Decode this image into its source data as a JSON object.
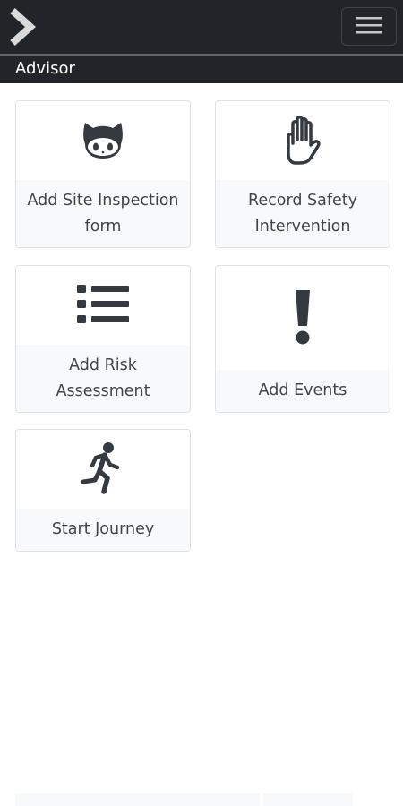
{
  "header": {
    "logo_icon": "chevron-right-icon",
    "menu_icon": "hamburger-menu-icon",
    "section_title": "Advisor"
  },
  "tiles": [
    {
      "icon": "github-octocat-icon",
      "label": "Add Site Inspection form"
    },
    {
      "icon": "raised-hand-icon",
      "label": "Record Safety Intervention"
    },
    {
      "icon": "list-icon",
      "label": "Add Risk Assessment"
    },
    {
      "icon": "exclamation-icon",
      "label": "Add Events"
    },
    {
      "icon": "running-person-icon",
      "label": "Start Journey"
    }
  ],
  "colors": {
    "header_bg": "#212529",
    "icon": "#343a40",
    "tile_label_bg": "#f8f9fa",
    "tile_border": "#dee2e6",
    "label_text": "#444444"
  }
}
